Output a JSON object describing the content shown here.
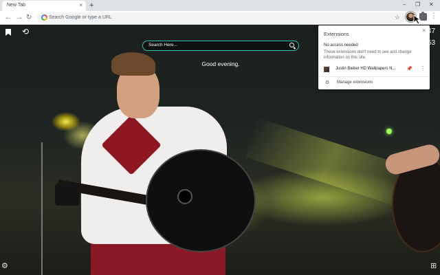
{
  "browser": {
    "tab_title": "New Tab",
    "tab_close": "×",
    "new_tab": "+",
    "window_minimize": "–",
    "window_restore": "❐",
    "window_close": "✕",
    "omnibox_placeholder": "Search Google or type a URL",
    "star": "☆",
    "menu": "⋮"
  },
  "page": {
    "search_placeholder": "Search Here...",
    "greeting": "Good evening.",
    "weather_top": "47",
    "weather_bottom": "53"
  },
  "extensions_popup": {
    "title": "Extensions",
    "close": "×",
    "section_heading": "No access needed",
    "section_desc": "These extensions don't need to see and change information on this site.",
    "extension_name": "Justin Bieber HD Wallpapers N...",
    "manage_label": "Manage extensions"
  },
  "icons": {
    "back": "back-arrow-icon",
    "forward": "forward-arrow-icon",
    "reload": "reload-icon",
    "bookmark": "bookmark-icon",
    "history": "history-icon",
    "settings": "gear-icon",
    "apps": "apps-grid-icon",
    "pin": "pin-icon",
    "extensions": "puzzle-icon"
  },
  "colors": {
    "search_border": "#2fc7b5",
    "pin_blue": "#1a73e8"
  }
}
